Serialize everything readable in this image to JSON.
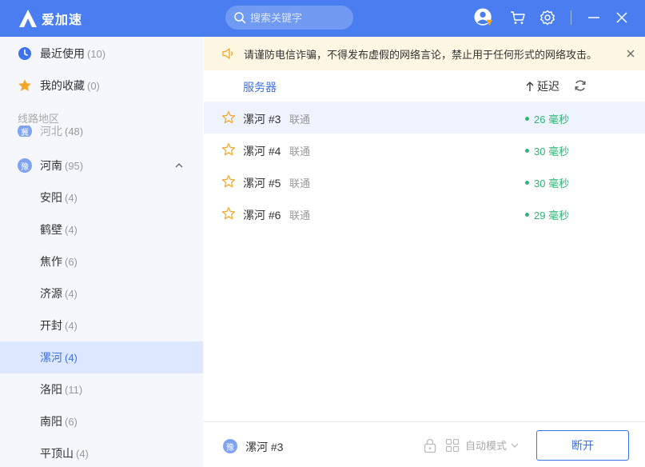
{
  "app": {
    "name": "爱加速"
  },
  "search": {
    "placeholder": "搜索关键字"
  },
  "sidebar": {
    "recent": {
      "label": "最近使用",
      "count": "(10)"
    },
    "favorites": {
      "label": "我的收藏",
      "count": "(0)"
    },
    "section_label": "线路地区",
    "partial_region": {
      "label": "河北",
      "count": "(48)",
      "badge": "冀"
    },
    "region": {
      "label": "河南",
      "count": "(95)",
      "badge": "豫"
    },
    "cities": [
      {
        "label": "安阳",
        "count": "(4)"
      },
      {
        "label": "鹤壁",
        "count": "(4)"
      },
      {
        "label": "焦作",
        "count": "(6)"
      },
      {
        "label": "济源",
        "count": "(4)"
      },
      {
        "label": "开封",
        "count": "(4)"
      },
      {
        "label": "漯河",
        "count": "(4)"
      },
      {
        "label": "洛阳",
        "count": "(11)"
      },
      {
        "label": "南阳",
        "count": "(6)"
      },
      {
        "label": "平顶山",
        "count": "(4)"
      }
    ]
  },
  "notice": {
    "text": "请谨防电信诈骗，不得发布虚假的网络言论，禁止用于任何形式的网络攻击。"
  },
  "table": {
    "col_server": "服务器",
    "col_latency": "延迟",
    "rows": [
      {
        "name": "漯河 #3",
        "isp": "联通",
        "latency": "26 毫秒"
      },
      {
        "name": "漯河 #4",
        "isp": "联通",
        "latency": "30 毫秒"
      },
      {
        "name": "漯河 #5",
        "isp": "联通",
        "latency": "30 毫秒"
      },
      {
        "name": "漯河 #6",
        "isp": "联通",
        "latency": "29 毫秒"
      }
    ]
  },
  "footer": {
    "badge": "豫",
    "current_server": "漯河 #3",
    "mode_label": "自动模式",
    "disconnect_label": "断开"
  },
  "colors": {
    "accent": "#4a7ef0",
    "latency_good": "#2bb673",
    "notice_bg": "#fdf7e3",
    "selected_bg": "#dde7fd"
  }
}
